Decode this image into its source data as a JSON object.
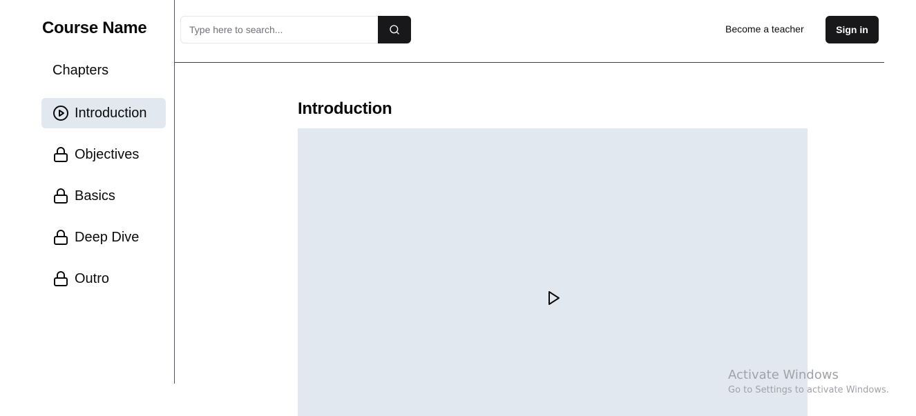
{
  "sidebar": {
    "course_title": "Course Name",
    "chapters_label": "Chapters",
    "items": [
      {
        "label": "Introduction",
        "icon": "play-circle-icon",
        "active": true
      },
      {
        "label": "Objectives",
        "icon": "lock-icon",
        "active": false
      },
      {
        "label": "Basics",
        "icon": "lock-icon",
        "active": false
      },
      {
        "label": "Deep Dive",
        "icon": "lock-icon",
        "active": false
      },
      {
        "label": "Outro",
        "icon": "lock-icon",
        "active": false
      }
    ]
  },
  "header": {
    "search_placeholder": "Type here to search...",
    "search_icon": "search-icon",
    "become_teacher": "Become a teacher",
    "sign_in": "Sign in"
  },
  "main": {
    "title": "Introduction",
    "video_icon": "play-icon"
  },
  "watermark": {
    "line1": "Activate Windows",
    "line2": "Go to Settings to activate Windows."
  },
  "colors": {
    "accent_dark": "#18181b",
    "active_bg": "#e2e8f0",
    "video_bg": "#e2e8f0"
  }
}
